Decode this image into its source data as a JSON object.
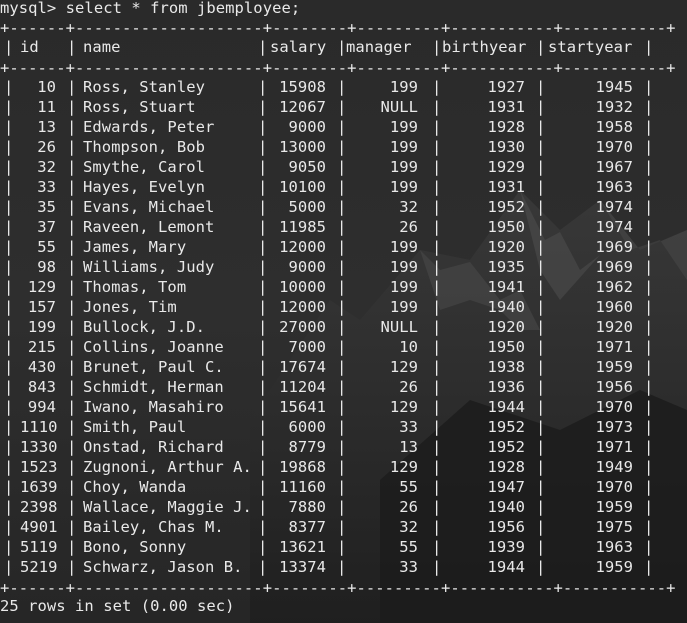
{
  "terminal": {
    "prompt": "mysql> select * from jbemployee;",
    "border": "+------+--------------------+--------+---------+-----------+-----------+",
    "footer": "25 rows in set (0.00 sec)"
  },
  "table": {
    "columns": [
      "id",
      "name",
      "salary",
      "manager",
      "birthyear",
      "startyear"
    ],
    "rows": [
      [
        "10",
        "Ross, Stanley",
        "15908",
        "199",
        "1927",
        "1945"
      ],
      [
        "11",
        "Ross, Stuart",
        "12067",
        "NULL",
        "1931",
        "1932"
      ],
      [
        "13",
        "Edwards, Peter",
        "9000",
        "199",
        "1928",
        "1958"
      ],
      [
        "26",
        "Thompson, Bob",
        "13000",
        "199",
        "1930",
        "1970"
      ],
      [
        "32",
        "Smythe, Carol",
        "9050",
        "199",
        "1929",
        "1967"
      ],
      [
        "33",
        "Hayes, Evelyn",
        "10100",
        "199",
        "1931",
        "1963"
      ],
      [
        "35",
        "Evans, Michael",
        "5000",
        "32",
        "1952",
        "1974"
      ],
      [
        "37",
        "Raveen, Lemont",
        "11985",
        "26",
        "1950",
        "1974"
      ],
      [
        "55",
        "James, Mary",
        "12000",
        "199",
        "1920",
        "1969"
      ],
      [
        "98",
        "Williams, Judy",
        "9000",
        "199",
        "1935",
        "1969"
      ],
      [
        "129",
        "Thomas, Tom",
        "10000",
        "199",
        "1941",
        "1962"
      ],
      [
        "157",
        "Jones, Tim",
        "12000",
        "199",
        "1940",
        "1960"
      ],
      [
        "199",
        "Bullock, J.D.",
        "27000",
        "NULL",
        "1920",
        "1920"
      ],
      [
        "215",
        "Collins, Joanne",
        "7000",
        "10",
        "1950",
        "1971"
      ],
      [
        "430",
        "Brunet, Paul C.",
        "17674",
        "129",
        "1938",
        "1959"
      ],
      [
        "843",
        "Schmidt, Herman",
        "11204",
        "26",
        "1936",
        "1956"
      ],
      [
        "994",
        "Iwano, Masahiro",
        "15641",
        "129",
        "1944",
        "1970"
      ],
      [
        "1110",
        "Smith, Paul",
        "6000",
        "33",
        "1952",
        "1973"
      ],
      [
        "1330",
        "Onstad, Richard",
        "8779",
        "13",
        "1952",
        "1971"
      ],
      [
        "1523",
        "Zugnoni, Arthur A.",
        "19868",
        "129",
        "1928",
        "1949"
      ],
      [
        "1639",
        "Choy, Wanda",
        "11160",
        "55",
        "1947",
        "1970"
      ],
      [
        "2398",
        "Wallace, Maggie J.",
        "7880",
        "26",
        "1940",
        "1959"
      ],
      [
        "4901",
        "Bailey, Chas M.",
        "8377",
        "32",
        "1956",
        "1975"
      ],
      [
        "5119",
        "Bono, Sonny",
        "13621",
        "55",
        "1939",
        "1963"
      ],
      [
        "5219",
        "Schwarz, Jason B.",
        "13374",
        "33",
        "1944",
        "1959"
      ]
    ]
  },
  "colors": {
    "background": "#2b2b2b",
    "text": "#e9e9e9"
  }
}
